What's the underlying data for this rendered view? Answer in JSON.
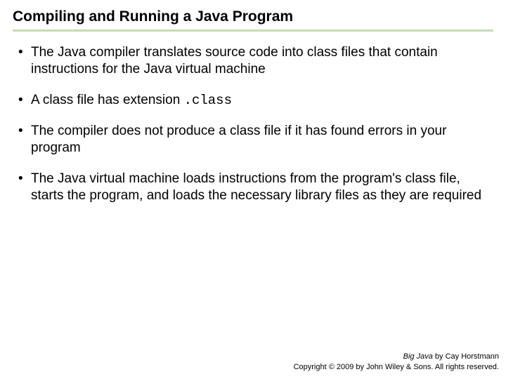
{
  "title": "Compiling and Running a Java Program",
  "bullets": [
    {
      "text": "The Java compiler translates source code into class files that contain instructions for the Java virtual machine"
    },
    {
      "prefix": "A class file has extension ",
      "code": ".class"
    },
    {
      "text": "The compiler does not produce a class file if it has found errors in your program"
    },
    {
      "text": "The Java virtual machine loads instructions from the program's class file, starts the program, and loads the necessary library files as they are required"
    }
  ],
  "footer": {
    "book": "Big Java",
    "author_line": " by Cay Horstmann",
    "copyright": "Copyright © 2009 by John Wiley & Sons. All rights reserved."
  }
}
